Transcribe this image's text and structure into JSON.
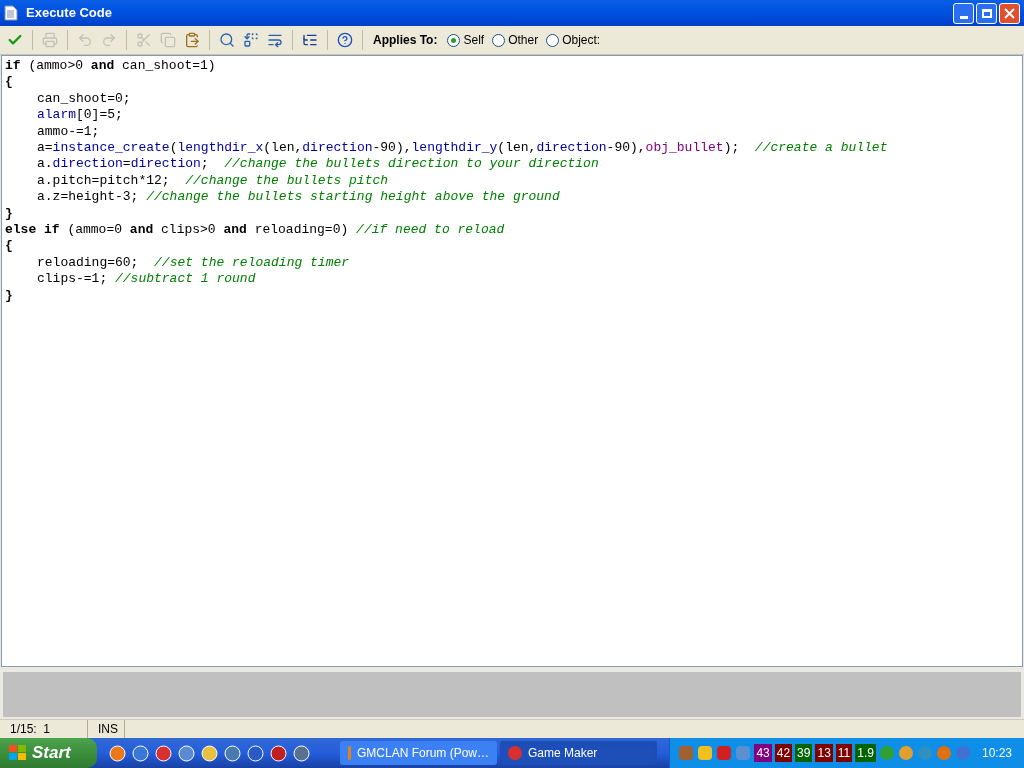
{
  "window": {
    "title": "Execute Code"
  },
  "toolbar": [
    {
      "kind": "accept",
      "disabled": false
    },
    {
      "kind": "sep"
    },
    {
      "kind": "print",
      "disabled": true
    },
    {
      "kind": "sep"
    },
    {
      "kind": "undo",
      "disabled": true
    },
    {
      "kind": "redo",
      "disabled": true
    },
    {
      "kind": "sep"
    },
    {
      "kind": "cut",
      "disabled": true
    },
    {
      "kind": "copy",
      "disabled": true
    },
    {
      "kind": "paste",
      "disabled": false
    },
    {
      "kind": "sep"
    },
    {
      "kind": "find",
      "disabled": false
    },
    {
      "kind": "replace",
      "disabled": false
    },
    {
      "kind": "goto",
      "disabled": false
    },
    {
      "kind": "sep"
    },
    {
      "kind": "tree",
      "disabled": false
    },
    {
      "kind": "sep"
    },
    {
      "kind": "help",
      "disabled": false
    },
    {
      "kind": "sep"
    }
  ],
  "applies_to": {
    "label": "Applies To:",
    "options": [
      {
        "label": "Self",
        "selected": true
      },
      {
        "label": "Other",
        "selected": false
      },
      {
        "label": "Object:",
        "selected": false
      }
    ]
  },
  "code_lines": [
    {
      "indented": false,
      "tokens": [
        {
          "kind": "keyword",
          "text": "if"
        },
        {
          "kind": "text",
          "text": " (ammo>0 "
        },
        {
          "kind": "keyword",
          "text": "and"
        },
        {
          "kind": "text",
          "text": " can_shoot=1)"
        }
      ]
    },
    {
      "indented": false,
      "tokens": [
        {
          "kind": "keyword",
          "text": "{"
        }
      ]
    },
    {
      "indented": true,
      "tokens": [
        {
          "kind": "text",
          "text": "can_shoot=0;"
        }
      ]
    },
    {
      "indented": true,
      "tokens": [
        {
          "kind": "builtin",
          "text": "alarm"
        },
        {
          "kind": "text",
          "text": "[0]=5;"
        }
      ]
    },
    {
      "indented": true,
      "tokens": [
        {
          "kind": "text",
          "text": "ammo-=1;"
        }
      ]
    },
    {
      "indented": true,
      "tokens": [
        {
          "kind": "text",
          "text": "a="
        },
        {
          "kind": "builtin",
          "text": "instance_create"
        },
        {
          "kind": "text",
          "text": "("
        },
        {
          "kind": "builtin",
          "text": "lengthdir_x"
        },
        {
          "kind": "text",
          "text": "(len,"
        },
        {
          "kind": "builtin",
          "text": "direction"
        },
        {
          "kind": "text",
          "text": "-90),"
        },
        {
          "kind": "builtin",
          "text": "lengthdir_y"
        },
        {
          "kind": "text",
          "text": "(len,"
        },
        {
          "kind": "builtin",
          "text": "direction"
        },
        {
          "kind": "text",
          "text": "-90),"
        },
        {
          "kind": "resource",
          "text": "obj_bullet"
        },
        {
          "kind": "text",
          "text": ");  "
        },
        {
          "kind": "comment",
          "text": "//create a bullet"
        }
      ]
    },
    {
      "indented": true,
      "tokens": [
        {
          "kind": "text",
          "text": "a."
        },
        {
          "kind": "builtin",
          "text": "direction"
        },
        {
          "kind": "text",
          "text": "="
        },
        {
          "kind": "builtin",
          "text": "direction"
        },
        {
          "kind": "text",
          "text": ";  "
        },
        {
          "kind": "comment",
          "text": "//change the bullets direction to your direction"
        }
      ]
    },
    {
      "indented": true,
      "tokens": [
        {
          "kind": "text",
          "text": "a.pitch=pitch*12;  "
        },
        {
          "kind": "comment",
          "text": "//change the bullets pitch"
        }
      ]
    },
    {
      "indented": true,
      "tokens": [
        {
          "kind": "text",
          "text": "a.z=height-3; "
        },
        {
          "kind": "comment",
          "text": "//change the bullets starting height above the ground"
        }
      ]
    },
    {
      "indented": false,
      "tokens": [
        {
          "kind": "keyword",
          "text": "}"
        }
      ]
    },
    {
      "indented": false,
      "tokens": [
        {
          "kind": "keyword",
          "text": "else if"
        },
        {
          "kind": "text",
          "text": " (ammo=0 "
        },
        {
          "kind": "keyword",
          "text": "and"
        },
        {
          "kind": "text",
          "text": " clips>0 "
        },
        {
          "kind": "keyword",
          "text": "and"
        },
        {
          "kind": "text",
          "text": " reloading=0) "
        },
        {
          "kind": "comment",
          "text": "//if need to reload"
        }
      ]
    },
    {
      "indented": false,
      "tokens": [
        {
          "kind": "keyword",
          "text": "{"
        }
      ]
    },
    {
      "indented": true,
      "tokens": [
        {
          "kind": "text",
          "text": "reloading=60;  "
        },
        {
          "kind": "comment",
          "text": "//set the reloading timer"
        }
      ]
    },
    {
      "indented": true,
      "tokens": [
        {
          "kind": "text",
          "text": "clips-=1; "
        },
        {
          "kind": "comment",
          "text": "//subtract 1 round"
        }
      ]
    },
    {
      "indented": false,
      "tokens": [
        {
          "kind": "keyword",
          "text": "}"
        }
      ]
    }
  ],
  "status_bar": {
    "position": "1/15:  1",
    "mode": "INS"
  },
  "taskbar": {
    "start": "Start",
    "tasks": [
      {
        "label": "GMCLAN Forum (Pow…",
        "selected": false
      },
      {
        "label": "Game Maker",
        "selected": true
      }
    ],
    "tray_readings": [
      {
        "text": "43",
        "color": "#800080"
      },
      {
        "text": "42",
        "color": "#800000"
      },
      {
        "text": "39",
        "color": "#006400"
      },
      {
        "text": "13",
        "color": "#800000"
      },
      {
        "text": "11",
        "color": "#800000"
      },
      {
        "text": "1.9",
        "color": "#006400"
      }
    ],
    "clock": "10:23"
  }
}
